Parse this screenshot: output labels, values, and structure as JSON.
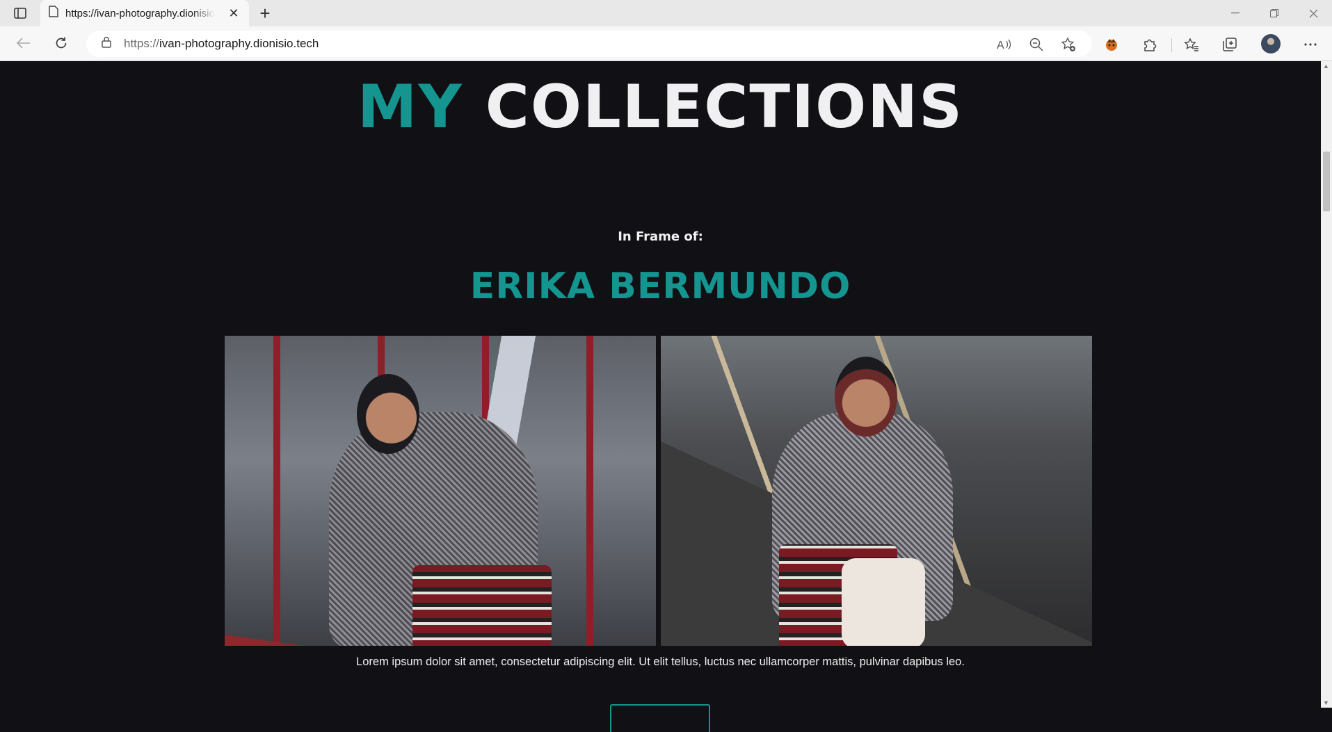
{
  "browser": {
    "tab_title": "https://ivan-photography.dionisio.tech",
    "url_scheme": "https://",
    "url_host": "ivan-photography.dionisio.tech"
  },
  "page": {
    "heading_accent": "MY",
    "heading_rest": "COLLECTIONS",
    "in_frame_label": "In Frame of:",
    "model_name": "ERIKA BERMUNDO",
    "caption": "Lorem ipsum dolor sit amet, consectetur adipiscing elit. Ut elit tellus, luctus nec ullamcorper mattis, pulvinar dapibus leo."
  },
  "colors": {
    "accent": "#14958f",
    "page_background": "#101015",
    "heading_light": "#f0f0f2"
  },
  "icons": {
    "tab_actions": "tab-actions-icon",
    "page": "page-icon",
    "close": "close-icon",
    "new_tab": "plus-icon",
    "back": "arrow-left-icon",
    "refresh": "refresh-icon",
    "lock": "lock-icon",
    "read_aloud": "read-aloud-icon",
    "zoom": "zoom-out-icon",
    "favorite": "star-add-icon",
    "extension": "extension-icon",
    "puzzle": "puzzle-icon",
    "favorites": "favorites-icon",
    "collections": "collections-icon",
    "more": "ellipsis-icon",
    "scroll_top": "arrow-up-icon"
  }
}
